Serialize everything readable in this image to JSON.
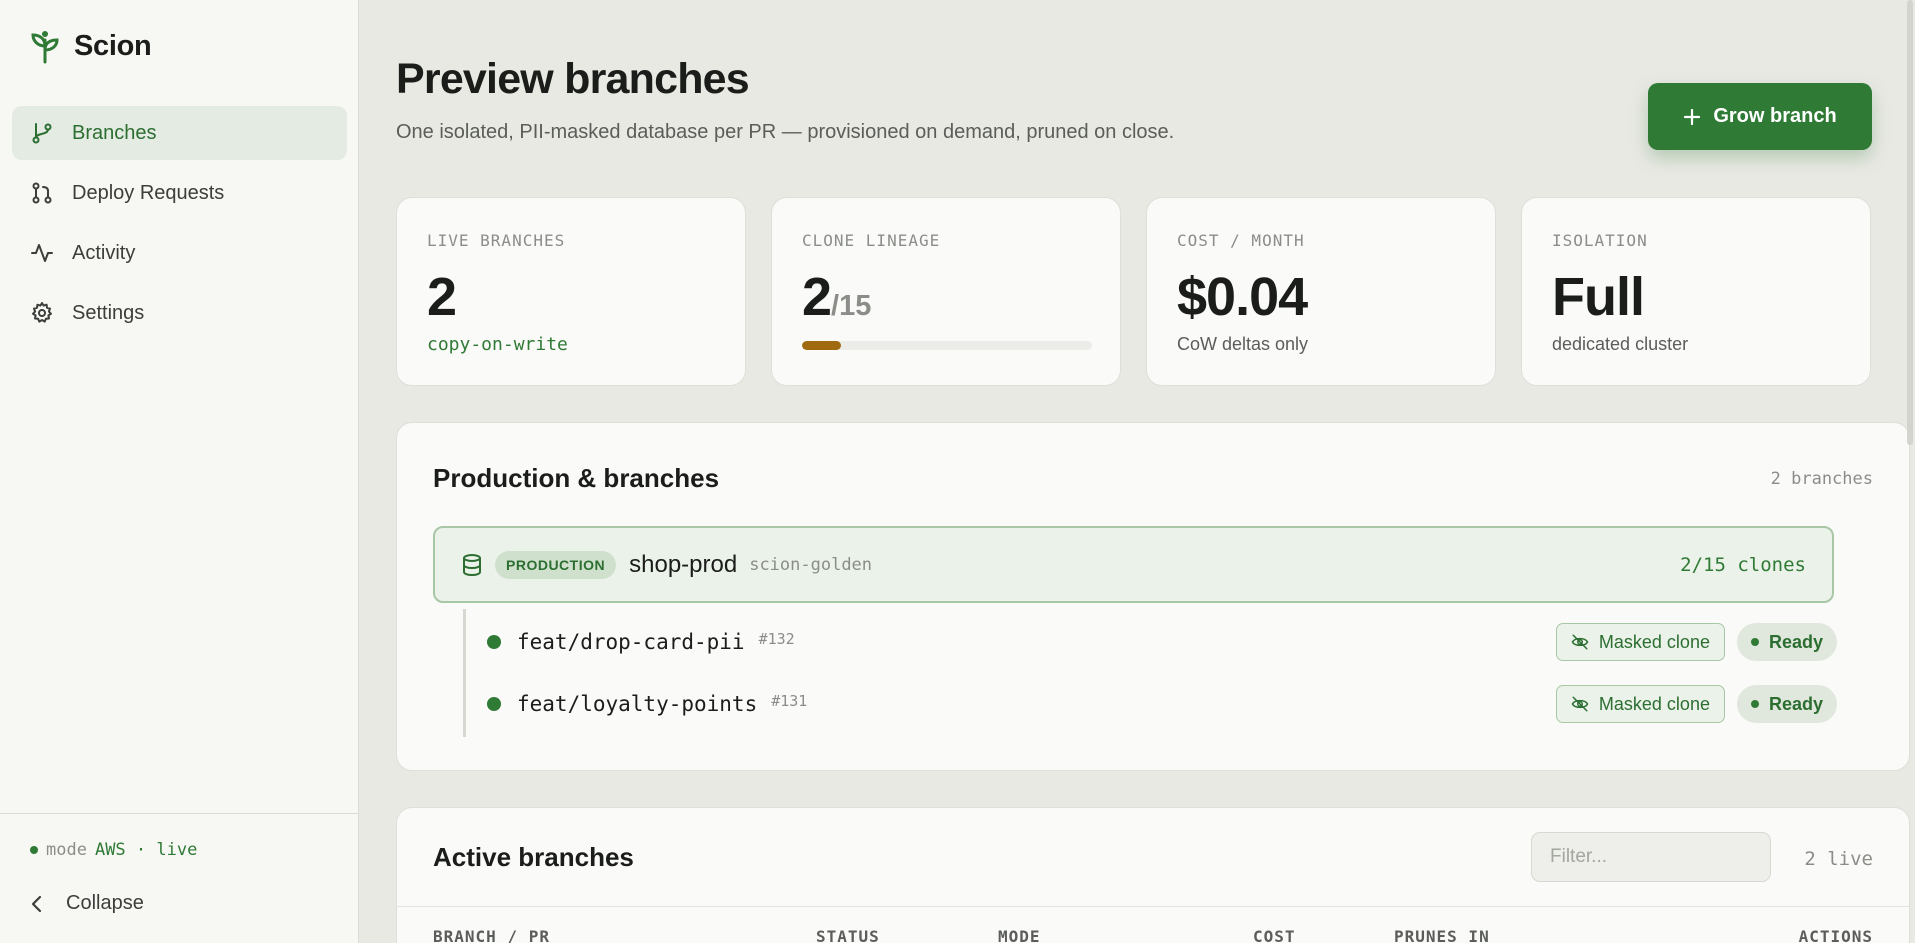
{
  "app": {
    "name": "Scion"
  },
  "sidebar": {
    "items": [
      {
        "label": "Branches",
        "icon": "git-branch-icon",
        "active": true
      },
      {
        "label": "Deploy Requests",
        "icon": "git-pull-request-icon",
        "active": false
      },
      {
        "label": "Activity",
        "icon": "activity-icon",
        "active": false
      },
      {
        "label": "Settings",
        "icon": "gear-icon",
        "active": false
      }
    ],
    "mode_prefix": "mode",
    "mode_value": "AWS · live",
    "collapse_label": "Collapse"
  },
  "header": {
    "title": "Preview branches",
    "subtitle": "One isolated, PII-masked database per PR — provisioned on demand, pruned on close.",
    "grow_button": "Grow branch"
  },
  "stats": [
    {
      "label": "LIVE BRANCHES",
      "value": "2",
      "note": "copy-on-write"
    },
    {
      "label": "CLONE LINEAGE",
      "value": "2",
      "of": "/15",
      "progress": 0.133
    },
    {
      "label": "COST / MONTH",
      "value": "$0.04",
      "note": "CoW deltas only"
    },
    {
      "label": "ISOLATION",
      "value": "Full",
      "note": "dedicated cluster"
    }
  ],
  "production": {
    "title": "Production & branches",
    "count": "2 branches",
    "badge": "PRODUCTION",
    "name": "shop-prod",
    "cluster": "scion-golden",
    "clones": "2/15 clones",
    "branches": [
      {
        "name": "feat/drop-card-pii",
        "pr": "#132",
        "mask_label": "Masked clone",
        "status": "Ready"
      },
      {
        "name": "feat/loyalty-points",
        "pr": "#131",
        "mask_label": "Masked clone",
        "status": "Ready"
      }
    ]
  },
  "active": {
    "title": "Active branches",
    "filter_placeholder": "Filter...",
    "live_count": "2 live",
    "columns": [
      "BRANCH / PR",
      "STATUS",
      "MODE",
      "COST",
      "PRUNES IN",
      "ACTIONS"
    ]
  },
  "colors": {
    "accent": "#2f7a35",
    "progress": "#a06a10",
    "background": "#e9e9e4"
  }
}
